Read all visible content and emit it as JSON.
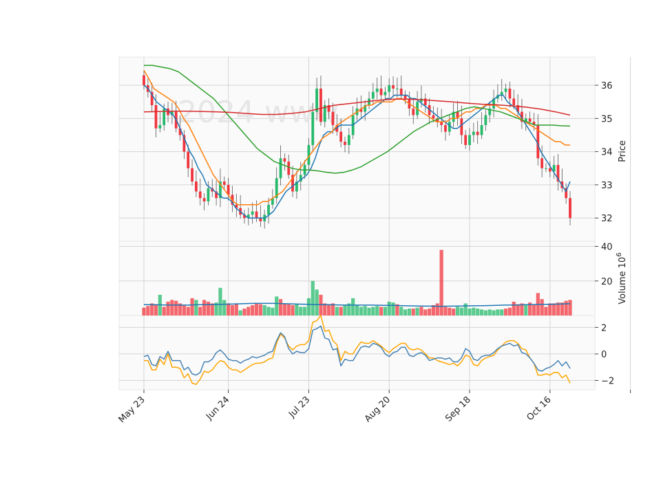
{
  "chart_data": {
    "type": "candlestick",
    "x_tick_labels": [
      "May 23",
      "Jun 24",
      "Jul 23",
      "Aug 20",
      "Sep 18",
      "Oct 16"
    ],
    "x_tick_index": [
      0,
      21,
      41,
      61,
      81,
      101,
      121
    ],
    "watermark": "2024 www.",
    "colors": {
      "up": "#26b96b",
      "down": "#f0363e",
      "ma_blue": "#1f77b4",
      "ma_orange": "#ff7f0e",
      "ma_green": "#2ca02c",
      "ma_red": "#d62728",
      "osc_a": "#4682b4",
      "osc_b": "#ffa500"
    },
    "price_panel": {
      "ylabel": "Price",
      "ticks": [
        32,
        33,
        34,
        35,
        36
      ],
      "ylim": [
        31.3,
        36.85
      ],
      "close": [
        36.0,
        35.8,
        35.4,
        34.7,
        34.8,
        35.3,
        35.1,
        35.2,
        34.7,
        34.5,
        34.0,
        33.5,
        33.1,
        32.8,
        32.6,
        32.5,
        32.9,
        32.8,
        32.6,
        33.1,
        33.0,
        32.7,
        32.4,
        32.3,
        32.1,
        32.0,
        32.1,
        32.2,
        32.0,
        31.9,
        32.1,
        32.4,
        32.6,
        33.2,
        33.8,
        33.7,
        33.3,
        32.8,
        33.1,
        33.3,
        33.6,
        34.2,
        35.2,
        35.9,
        34.9,
        35.4,
        35.2,
        34.8,
        34.6,
        34.3,
        34.2,
        34.5,
        35.1,
        35.3,
        35.2,
        35.4,
        35.6,
        35.8,
        35.9,
        35.7,
        35.8,
        36.0,
        35.9,
        35.9,
        35.7,
        35.6,
        35.3,
        35.1,
        35.5,
        35.6,
        35.4,
        35.1,
        35.0,
        34.9,
        34.8,
        34.6,
        34.9,
        35.2,
        35.0,
        34.5,
        34.2,
        34.5,
        34.6,
        34.5,
        34.8,
        35.1,
        35.3,
        35.6,
        35.7,
        35.8,
        35.9,
        35.6,
        35.4,
        35.2,
        34.9,
        35.0,
        34.9,
        34.8,
        33.8,
        33.5,
        33.5,
        33.4,
        33.6,
        33.1,
        32.9,
        32.6,
        32.0
      ],
      "ma": [
        {
          "name": "ma_blue",
          "values": [
            36.0,
            35.9,
            35.7,
            35.5,
            35.4,
            35.3,
            35.2,
            35.1,
            34.9,
            34.6,
            34.3,
            34.0,
            33.8,
            33.5,
            33.3,
            33.0,
            32.9,
            32.8,
            32.7,
            32.6,
            32.6,
            32.5,
            32.3,
            32.2,
            32.1,
            32.0,
            32.0,
            32.0,
            32.0,
            32.0,
            32.1,
            32.2,
            32.4,
            32.6,
            32.8,
            32.9,
            33.0,
            33.1,
            33.2,
            33.3,
            33.5,
            33.8,
            34.2,
            34.5,
            34.6,
            34.6,
            34.7,
            34.8,
            34.8,
            34.8,
            34.8,
            34.9,
            35.0,
            35.1,
            35.2,
            35.3,
            35.4,
            35.5,
            35.6,
            35.6,
            35.7,
            35.7,
            35.7,
            35.7,
            35.6,
            35.6,
            35.5,
            35.4,
            35.3,
            35.2,
            35.1,
            35.0,
            34.9,
            34.8,
            34.7,
            34.7,
            34.8,
            34.9,
            35.0,
            35.1,
            35.2,
            35.3,
            35.4,
            35.5,
            35.6,
            35.7,
            35.7,
            35.5,
            35.4,
            35.3,
            35.1,
            34.9,
            34.7,
            34.5,
            34.3,
            34.0,
            33.8,
            33.6,
            33.4,
            33.2,
            33.0,
            32.8,
            33.1
          ]
        },
        {
          "name": "ma_orange",
          "values": [
            36.45,
            36.2,
            35.9,
            35.8,
            35.7,
            35.6,
            35.5,
            35.3,
            35.0,
            34.8,
            34.5,
            34.2,
            33.9,
            33.6,
            33.3,
            33.1,
            32.9,
            32.7,
            32.5,
            32.4,
            32.4,
            32.4,
            32.4,
            32.4,
            32.5,
            32.5,
            32.6,
            32.7,
            32.8,
            33.0,
            33.2,
            33.4,
            33.6,
            33.8,
            34.0,
            34.2,
            34.4,
            34.5,
            34.6,
            34.8,
            34.9,
            35.0,
            35.1,
            35.2,
            35.3,
            35.4,
            35.4,
            35.5,
            35.5,
            35.5,
            35.5,
            35.6,
            35.6,
            35.5,
            35.4,
            35.3,
            35.2,
            35.1,
            35.0,
            34.9,
            34.9,
            34.9,
            35.0,
            35.0,
            35.1,
            35.2,
            35.2,
            35.3,
            35.3,
            35.4,
            35.4,
            35.4,
            35.3,
            35.3,
            35.2,
            35.1,
            35.0,
            34.9,
            34.8,
            34.7,
            34.6,
            34.5,
            34.4,
            34.3,
            34.3,
            34.2,
            34.2
          ]
        },
        {
          "name": "ma_green",
          "values": [
            36.6,
            36.6,
            36.55,
            36.5,
            36.4,
            36.2,
            36.0,
            35.8,
            35.6,
            35.3,
            35.0,
            34.7,
            34.4,
            34.1,
            33.9,
            33.7,
            33.6,
            33.5,
            33.45,
            33.45,
            33.42,
            33.38,
            33.35,
            33.38,
            33.45,
            33.55,
            33.7,
            33.85,
            34.0,
            34.2,
            34.4,
            34.6,
            34.75,
            34.9,
            35.0,
            35.1,
            35.2,
            35.3,
            35.35,
            35.3,
            35.25,
            35.2,
            35.1,
            35.0,
            34.9,
            34.8,
            34.8,
            34.8,
            34.78,
            34.77
          ]
        },
        {
          "name": "ma_red",
          "values": [
            35.2,
            35.21,
            35.22,
            35.22,
            35.21,
            35.2,
            35.18,
            35.15,
            35.12,
            35.12,
            35.15,
            35.2,
            35.3,
            35.4,
            35.45,
            35.5,
            35.55,
            35.58,
            35.58,
            35.56,
            35.53,
            35.5,
            35.46,
            35.43,
            35.41,
            35.38,
            35.34,
            35.28,
            35.2,
            35.1
          ]
        }
      ]
    },
    "volume_panel": {
      "ylabel": "Volume  10^6",
      "ticks": [
        20,
        40
      ],
      "ylim": [
        0,
        43
      ],
      "values": [
        4.5,
        5.5,
        7.0,
        6.5,
        12.0,
        5.0,
        8.0,
        9.0,
        8.5,
        7.0,
        6.0,
        5.0,
        10.0,
        9.0,
        5.0,
        9.0,
        8.0,
        7.0,
        7.5,
        16.0,
        9.0,
        7.0,
        6.0,
        7.0,
        3.0,
        4.0,
        5.0,
        6.0,
        7.0,
        6.5,
        6.0,
        5.0,
        4.5,
        11.0,
        9.5,
        7.0,
        6.5,
        6.0,
        6.5,
        5.0,
        5.0,
        10.0,
        20.0,
        15.0,
        12.0,
        7.0,
        6.5,
        7.0,
        5.0,
        5.0,
        6.0,
        7.0,
        10.0,
        6.0,
        5.0,
        5.5,
        4.5,
        5.0,
        5.5,
        5.0,
        5.0,
        8.0,
        7.5,
        6.5,
        5.0,
        3.5,
        4.0,
        4.0,
        4.5,
        5.0,
        3.5,
        4.0,
        6.0,
        7.0,
        38.0,
        5.0,
        4.5,
        4.0,
        5.0,
        4.5,
        7.0,
        4.0,
        4.5,
        4.0,
        3.5,
        3.0,
        3.5,
        3.0,
        3.5,
        3.5,
        4.0,
        4.5,
        8.0,
        6.5,
        7.0,
        6.5,
        7.5,
        6.0,
        13.0,
        9.5,
        5.0,
        7.0,
        7.0,
        7.5,
        7.5,
        8.5,
        9.0
      ],
      "up_flags": [
        0,
        0,
        0,
        0,
        1,
        0,
        0,
        0,
        0,
        0,
        0,
        0,
        0,
        1,
        0,
        0,
        0,
        0,
        1,
        1,
        1,
        0,
        0,
        0,
        1,
        0,
        0,
        0,
        0,
        0,
        1,
        1,
        1,
        1,
        0,
        0,
        0,
        0,
        1,
        1,
        1,
        1,
        1,
        1,
        0,
        0,
        0,
        0,
        1,
        0,
        1,
        1,
        1,
        1,
        1,
        1,
        1,
        1,
        1,
        0,
        1,
        1,
        1,
        0,
        1,
        1,
        1,
        0,
        1,
        0,
        0,
        0,
        0,
        0,
        0,
        0,
        0,
        0,
        1,
        1,
        1,
        1,
        1,
        1,
        1,
        1,
        1,
        1,
        1,
        1,
        0,
        0,
        0,
        0,
        0,
        1,
        0,
        0,
        0,
        0,
        0,
        0,
        0,
        0,
        0,
        0,
        0
      ],
      "ma": [
        6.3,
        6.2,
        6.1,
        6.0,
        6.0,
        6.2,
        6.3,
        6.5,
        6.6,
        6.8,
        7.0,
        7.0,
        7.0,
        6.8,
        6.6,
        6.5,
        6.3,
        6.2,
        6.1,
        6.0,
        6.0,
        6.0,
        5.9,
        5.8,
        5.6,
        5.5,
        5.4,
        5.3,
        5.4,
        5.5,
        5.6,
        5.7,
        5.8,
        6.0,
        6.1,
        6.2,
        6.4,
        6.5,
        6.6,
        6.8
      ]
    },
    "osc_panel": {
      "ticks": [
        -2,
        0,
        2
      ],
      "ylim": [
        -2.7,
        2.9
      ],
      "series_a": [
        -0.2,
        -0.1,
        -0.8,
        -0.9,
        -0.2,
        -0.4,
        0.2,
        -0.5,
        -0.5,
        -0.5,
        -1.2,
        -1.0,
        -1.5,
        -1.6,
        -1.4,
        -0.6,
        -0.6,
        -0.4,
        0.1,
        0.3,
        0.0,
        -0.4,
        -0.5,
        -0.5,
        -0.7,
        -0.5,
        -0.4,
        -0.2,
        -0.3,
        -0.2,
        -0.1,
        0.1,
        0.2,
        1.0,
        1.6,
        1.3,
        0.4,
        0.0,
        0.2,
        0.1,
        0.1,
        0.4,
        1.8,
        1.9,
        2.1,
        1.2,
        1.1,
        0.3,
        0.4,
        -0.9,
        -0.4,
        -0.5,
        -0.5,
        0.0,
        0.5,
        0.6,
        0.5,
        0.8,
        0.7,
        0.5,
        0.0,
        -0.2,
        0.1,
        0.2,
        0.5,
        0.5,
        -0.1,
        -0.2,
        0.0,
        0.1,
        -0.1,
        -0.5,
        -0.4,
        -0.3,
        -0.3,
        -0.4,
        -0.3,
        -0.6,
        -0.6,
        -0.3,
        0.4,
        0.2,
        -0.4,
        -0.5,
        -0.2,
        -0.1,
        -0.1,
        0.1,
        0.4,
        0.6,
        0.7,
        0.8,
        0.6,
        0.7,
        0.1,
        0.0,
        -0.3,
        -0.7,
        -1.2,
        -1.3,
        -1.1,
        -1.0,
        -0.8,
        -0.5,
        -0.9,
        -0.6,
        -1.1
      ],
      "series_b": [
        -0.5,
        -0.5,
        -1.2,
        -1.2,
        -0.4,
        -0.8,
        0.0,
        -1.0,
        -1.0,
        -1.1,
        -1.8,
        -1.5,
        -2.2,
        -2.3,
        -1.9,
        -1.3,
        -1.4,
        -1.2,
        -0.8,
        -0.5,
        -0.6,
        -1.0,
        -1.2,
        -1.2,
        -1.4,
        -1.2,
        -1.0,
        -0.8,
        -0.7,
        -0.7,
        -0.6,
        -0.4,
        -0.3,
        0.8,
        1.5,
        1.2,
        0.6,
        0.3,
        0.6,
        0.7,
        0.7,
        1.0,
        2.4,
        2.5,
        2.9,
        1.7,
        1.8,
        1.0,
        0.7,
        -0.5,
        0.2,
        0.0,
        0.0,
        0.5,
        0.9,
        0.8,
        0.8,
        1.0,
        0.8,
        0.6,
        0.3,
        0.1,
        0.4,
        0.6,
        0.8,
        0.8,
        0.4,
        0.3,
        0.4,
        0.3,
        0.0,
        -0.3,
        -0.3,
        -0.5,
        -0.6,
        -0.7,
        -0.8,
        -0.7,
        -0.9,
        -0.6,
        -0.1,
        -0.2,
        -0.8,
        -0.9,
        -0.5,
        -0.3,
        -0.2,
        -0.1,
        0.3,
        0.6,
        0.9,
        1.0,
        1.0,
        0.8,
        0.4,
        0.3,
        -0.3,
        -0.7,
        -1.6,
        -1.6,
        -1.5,
        -1.6,
        -1.4,
        -1.4,
        -1.8,
        -1.6,
        -2.2
      ]
    }
  }
}
